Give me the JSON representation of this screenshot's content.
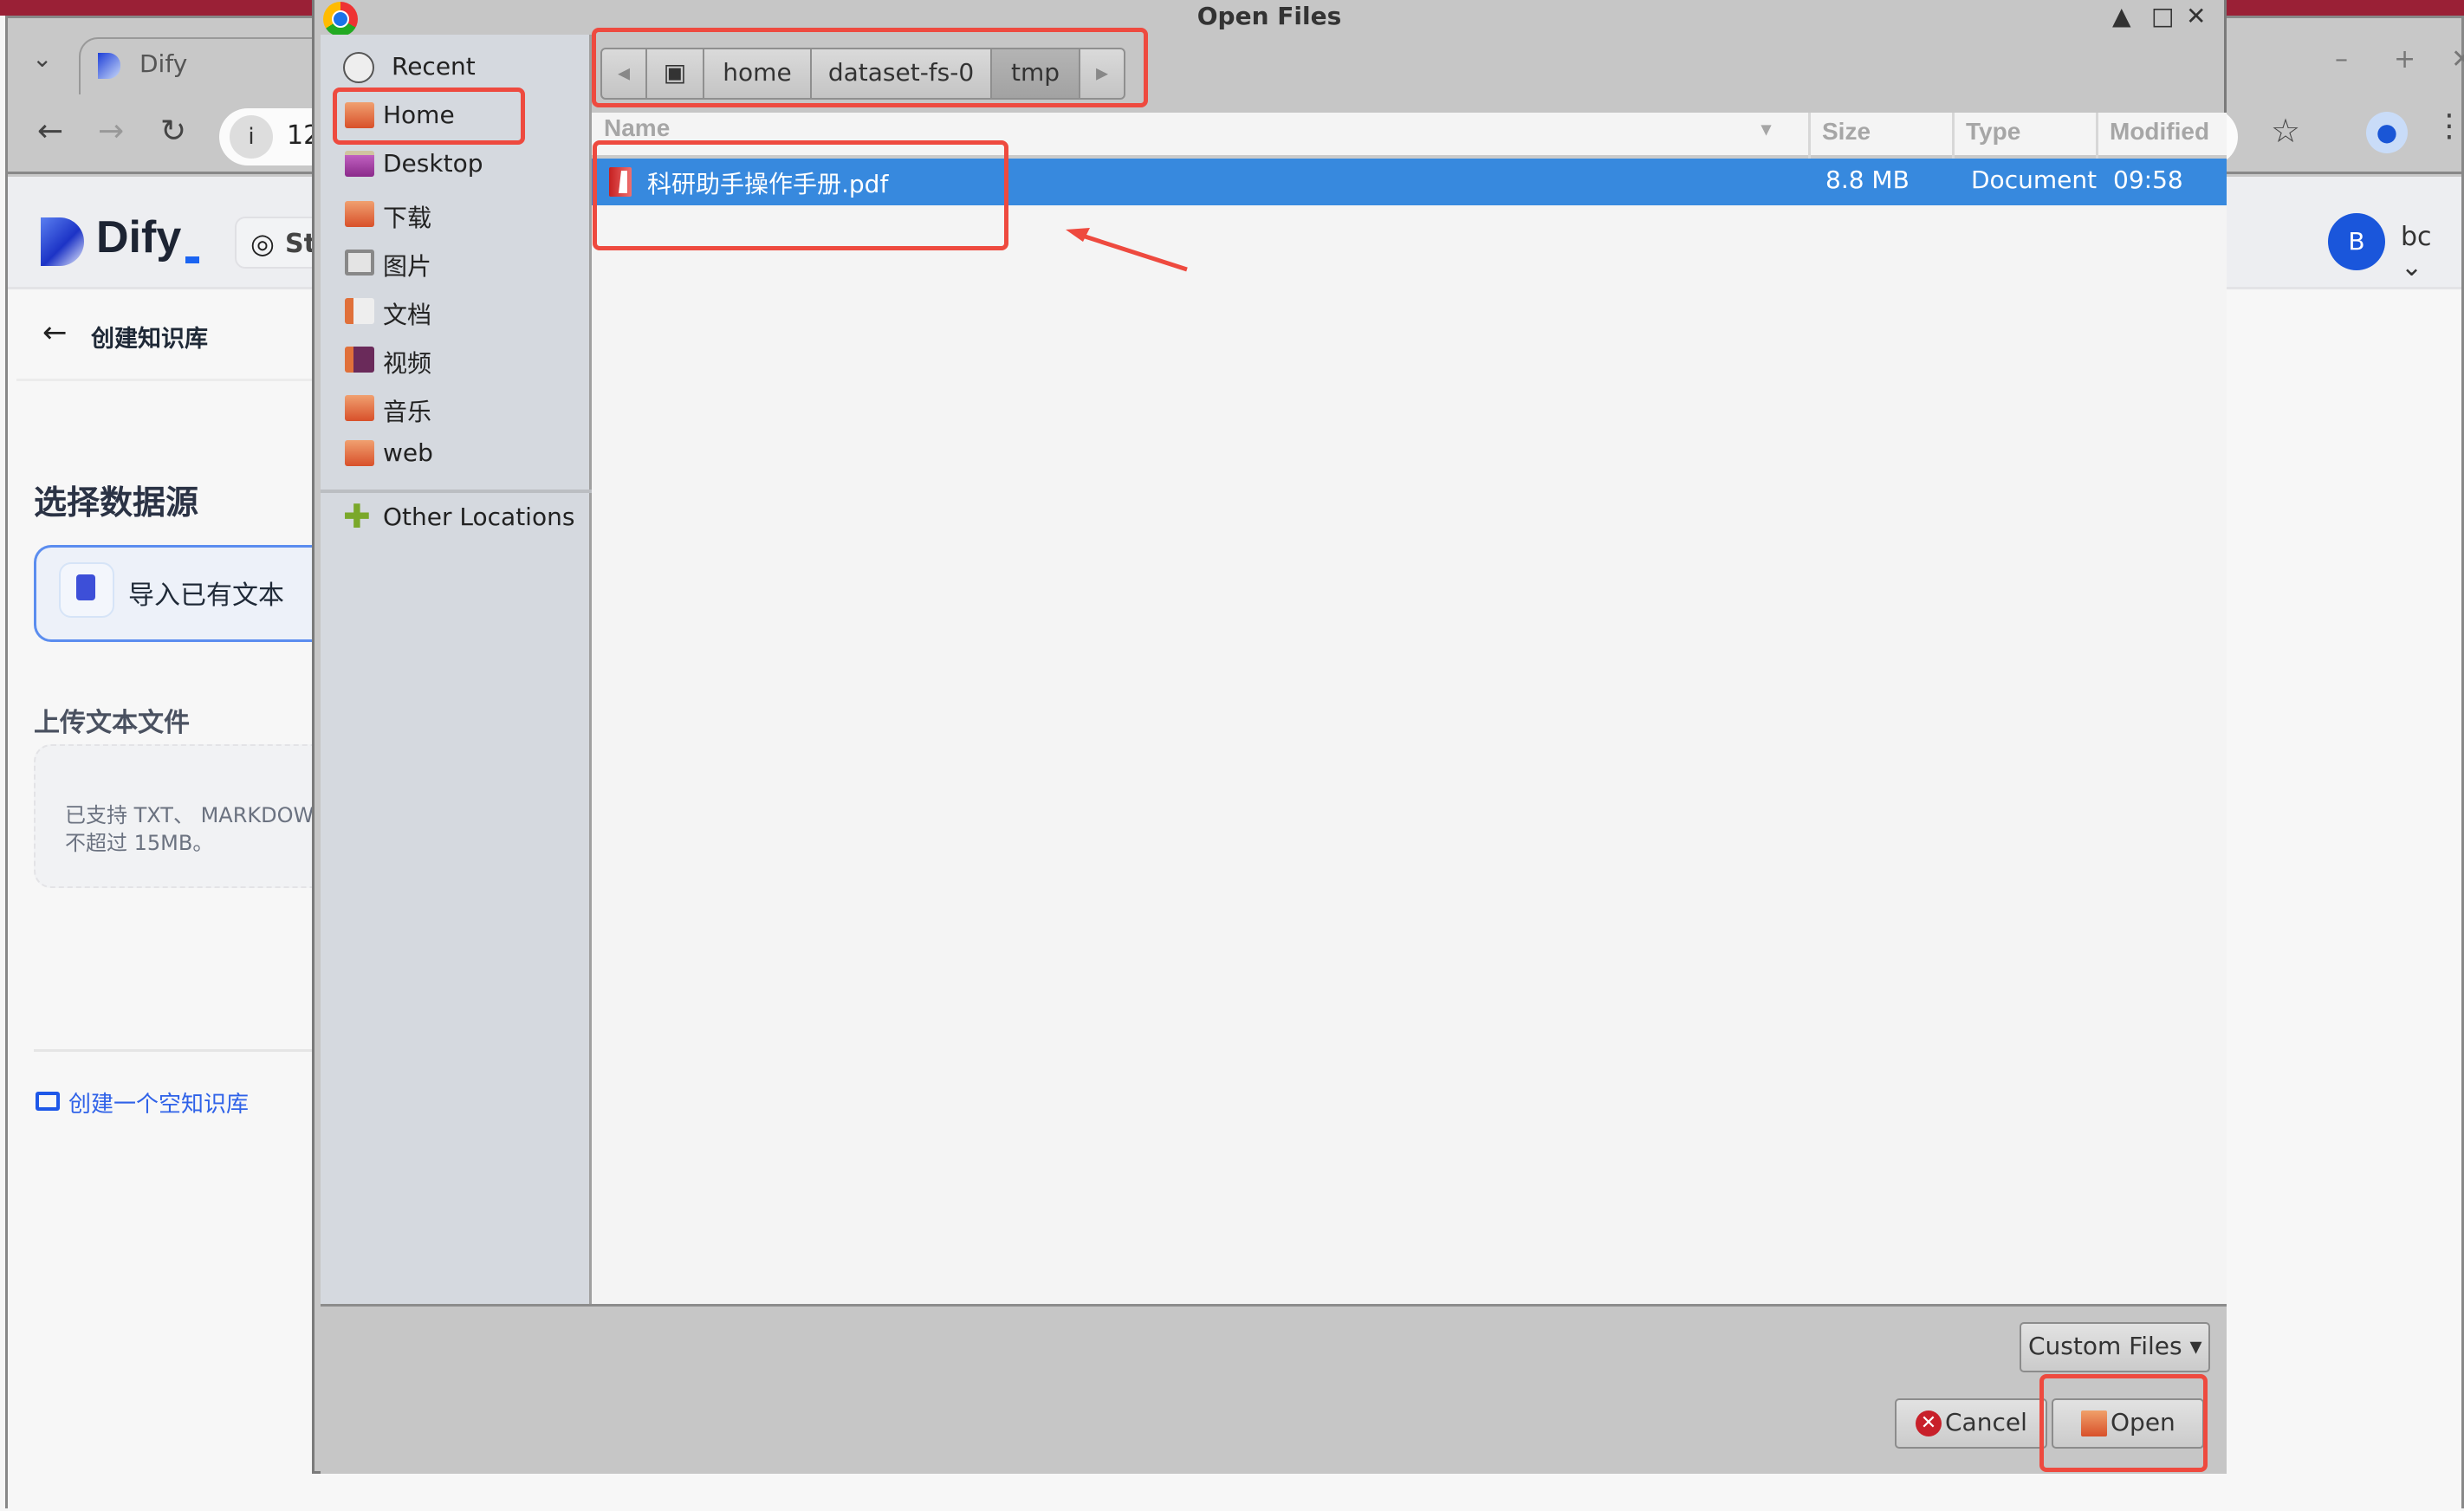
{
  "browser": {
    "tab_title": "Dify",
    "url_partial": "12",
    "window_controls": {
      "minimize": "–",
      "maximize": "+",
      "close": "✕"
    },
    "icons": {
      "tab_list": "⌄",
      "back": "←",
      "forward": "→",
      "reload": "↻",
      "info": "i",
      "star": "☆",
      "profile": "👤",
      "menu": "⋮"
    }
  },
  "dify": {
    "logo_text": "Dify",
    "github_label": "St",
    "github_icon": "◎",
    "user_avatar_letter": "B",
    "user_name": "bc ⌄",
    "back_icon": "←",
    "page_title": "创建知识库",
    "section_title": "选择数据源",
    "source_option": "导入已有文本",
    "upload_label": "上传文本文件",
    "dropzone_line1": "已支持 TXT、 MARKDOWN",
    "dropzone_line2": "不超过 15MB。",
    "create_empty_link": "创建一个空知识库"
  },
  "dialog": {
    "title": "Open Files",
    "controls": {
      "minimize": "▲",
      "maximize": "□",
      "close": "✕"
    },
    "places": [
      {
        "label": "Recent",
        "icon": "clock-icon"
      },
      {
        "label": "Home",
        "icon": "home-folder-icon"
      },
      {
        "label": "Desktop",
        "icon": "desktop-icon"
      },
      {
        "label": "下载",
        "icon": "downloads-folder-icon"
      },
      {
        "label": "图片",
        "icon": "pictures-folder-icon"
      },
      {
        "label": "文档",
        "icon": "documents-folder-icon"
      },
      {
        "label": "视频",
        "icon": "videos-folder-icon"
      },
      {
        "label": "音乐",
        "icon": "music-folder-icon"
      },
      {
        "label": "web",
        "icon": "folder-icon"
      },
      {
        "label": "Other Locations",
        "icon": "plus-icon"
      }
    ],
    "pathbar": {
      "back_arrow": "◂",
      "root_icon": "▣",
      "crumbs": [
        "home",
        "dataset-fs-0",
        "tmp"
      ],
      "forward_arrow": "▸",
      "active": "tmp"
    },
    "columns": {
      "name": "Name",
      "size": "Size",
      "type": "Type",
      "modified": "Modified",
      "sort_indicator": "▾"
    },
    "files": [
      {
        "name": "科研助手操作手册.pdf",
        "size": "8.8 MB",
        "type": "Document",
        "modified": "09:58",
        "selected": true
      }
    ],
    "filter": "Custom Files ▾",
    "cancel_label": "Cancel",
    "open_label": "Open"
  },
  "colors": {
    "selection": "#3789de",
    "annotation": "#ee4a3f",
    "dify_blue": "#1b64f2"
  }
}
